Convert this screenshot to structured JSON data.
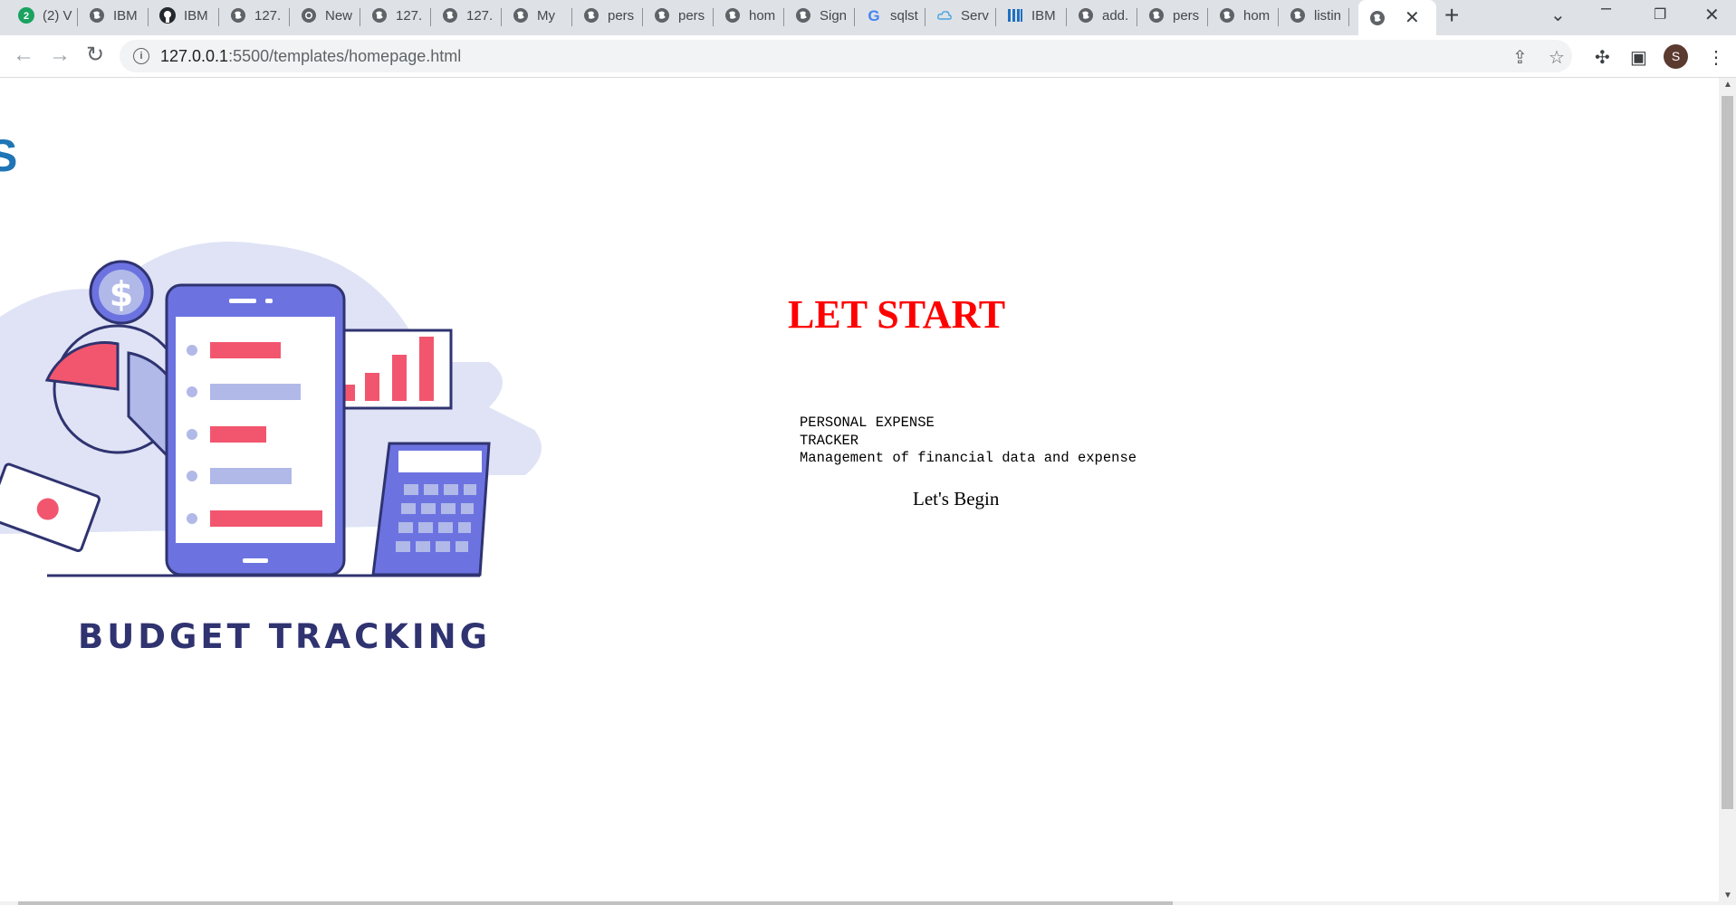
{
  "browser": {
    "tabs": [
      {
        "title": "(2) V",
        "icon": "badge-icon"
      },
      {
        "title": "IBM",
        "icon": "globe-icon"
      },
      {
        "title": "IBM",
        "icon": "github-icon"
      },
      {
        "title": "127.",
        "icon": "globe-icon"
      },
      {
        "title": "New",
        "icon": "chrome-icon"
      },
      {
        "title": "127.",
        "icon": "globe-icon"
      },
      {
        "title": "127.",
        "icon": "globe-icon"
      },
      {
        "title": "My",
        "icon": "globe-icon"
      },
      {
        "title": "pers",
        "icon": "globe-icon"
      },
      {
        "title": "pers",
        "icon": "globe-icon"
      },
      {
        "title": "hom",
        "icon": "globe-icon"
      },
      {
        "title": "Sign",
        "icon": "globe-icon"
      },
      {
        "title": "sqlst",
        "icon": "google-icon"
      },
      {
        "title": "Serv",
        "icon": "cloud-icon"
      },
      {
        "title": "IBM",
        "icon": "ibm-icon"
      },
      {
        "title": "add.",
        "icon": "globe-icon"
      },
      {
        "title": "pers",
        "icon": "globe-icon"
      },
      {
        "title": "hom",
        "icon": "globe-icon"
      },
      {
        "title": "listin",
        "icon": "globe-icon"
      }
    ],
    "active_tab_title": "",
    "badge_count": "2",
    "url_host": "127.0.0.1",
    "url_rest": ":5500/templates/homepage.html",
    "profile_initial": "S"
  },
  "page": {
    "logo_fragment": "S",
    "illustration_caption": "BUDGET TRACKING",
    "headline": "LET START",
    "desc_line1": "PERSONAL EXPENSE",
    "desc_line2": "TRACKER",
    "desc_line3": "Management of financial data and expense",
    "begin_label": "Let's Begin"
  },
  "colors": {
    "headline": "#ff0000",
    "caption": "#2f3370",
    "phone": "#6c73e0",
    "accent_pink": "#f2566e",
    "accent_lilac": "#b1b9e8"
  }
}
